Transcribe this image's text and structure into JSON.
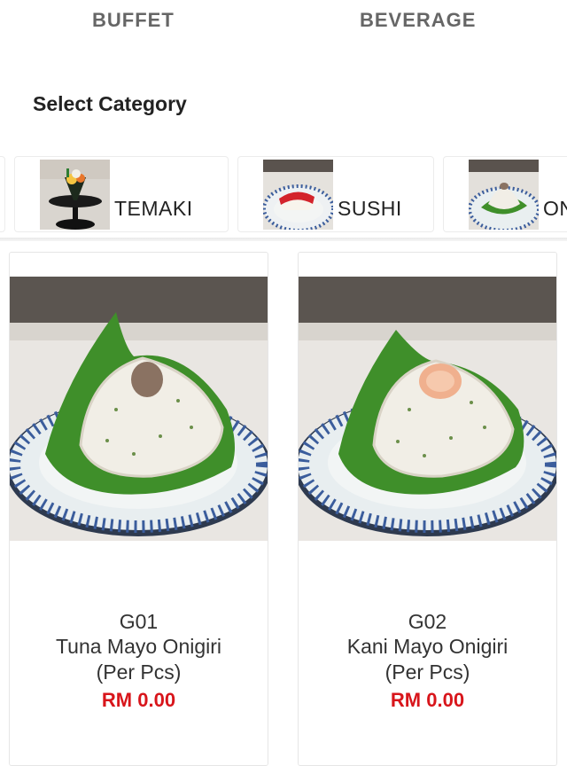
{
  "tabs": {
    "buffet": "BUFFET",
    "beverage": "BEVERAGE"
  },
  "section": {
    "title": "Select Category"
  },
  "categories": [
    {
      "label": "TEMAKI",
      "icon": "temaki-photo"
    },
    {
      "label": "SUSHI",
      "icon": "sushi-photo"
    },
    {
      "label": "ON",
      "icon": "onigiri-photo"
    }
  ],
  "products": [
    {
      "code": "G01",
      "name": "Tuna Mayo Onigiri",
      "unit": "(Per Pcs)",
      "price": "RM 0.00"
    },
    {
      "code": "G02",
      "name": "Kani Mayo Onigiri",
      "unit": "(Per Pcs)",
      "price": "RM 0.00"
    }
  ],
  "colors": {
    "price": "#d8151b",
    "plate_stripe": "#3b5d9c",
    "leaf": "#3f8f2a"
  }
}
